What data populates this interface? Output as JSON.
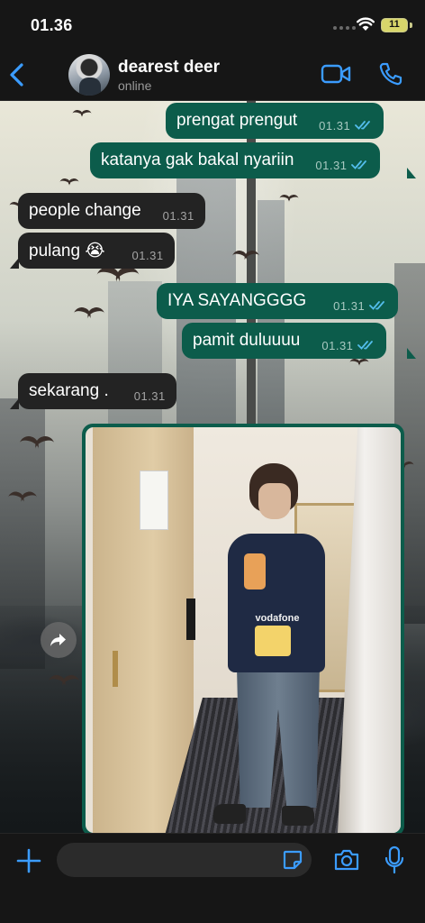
{
  "status_bar": {
    "time": "01.36",
    "battery": "11"
  },
  "header": {
    "contact_name": "dearest deer",
    "contact_status": "online",
    "icons": [
      "back-icon",
      "avatar",
      "video-call-icon",
      "voice-call-icon"
    ]
  },
  "messages": [
    {
      "direction": "outgoing",
      "text": "prengat prengut",
      "time": "01.31",
      "status": "read"
    },
    {
      "direction": "outgoing",
      "text": "katanya gak bakal nyariin",
      "time": "01.31",
      "status": "read"
    },
    {
      "direction": "incoming",
      "text": "people change",
      "time": "01.31"
    },
    {
      "direction": "incoming",
      "text": "pulang 😭",
      "time": "01.31"
    },
    {
      "direction": "outgoing",
      "text": "IYA SAYANGGGG",
      "time": "01.31",
      "status": "read"
    },
    {
      "direction": "outgoing",
      "text": "pamit duluuuu",
      "time": "01.31",
      "status": "read"
    },
    {
      "direction": "incoming",
      "text": "sekarang .",
      "time": "01.31"
    },
    {
      "direction": "outgoing",
      "type": "photo",
      "photo_shirt_text": "vodafone",
      "icon": "forward-icon"
    }
  ],
  "input_bar": {
    "placeholder": "",
    "icons": [
      "plus-icon",
      "sticker-icon",
      "camera-icon",
      "mic-icon"
    ]
  },
  "colors": {
    "outgoing_bubble": "#0c5c4b",
    "incoming_bubble": "#232323",
    "accent": "#3b9cff",
    "read_check": "#53bdeb"
  }
}
